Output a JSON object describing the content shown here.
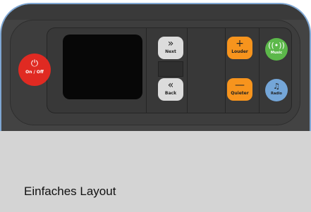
{
  "device": {
    "power": {
      "icon": "power-icon",
      "symbol": "⏻",
      "label": "On / Off",
      "color": "#e02a22"
    },
    "next": {
      "icon": "double-chevron-right-icon",
      "symbol": "»",
      "label": "Next"
    },
    "back": {
      "icon": "double-chevron-left-icon",
      "symbol": "«",
      "label": "Back"
    },
    "louder": {
      "icon": "plus-icon",
      "symbol": "+",
      "label": "Louder",
      "color": "#f7941d"
    },
    "quieter": {
      "icon": "minus-icon",
      "symbol": "—",
      "label": "Quieter",
      "color": "#f7941d"
    },
    "music": {
      "icon": "broadcast-icon",
      "symbol": "((•))",
      "label": "Music",
      "color": "#5cb84a"
    },
    "radio": {
      "icon": "music-note-icon",
      "symbol": "♫",
      "label": "Radio",
      "color": "#74a6d8"
    }
  },
  "footer": {
    "title": "Einfaches Layout"
  }
}
